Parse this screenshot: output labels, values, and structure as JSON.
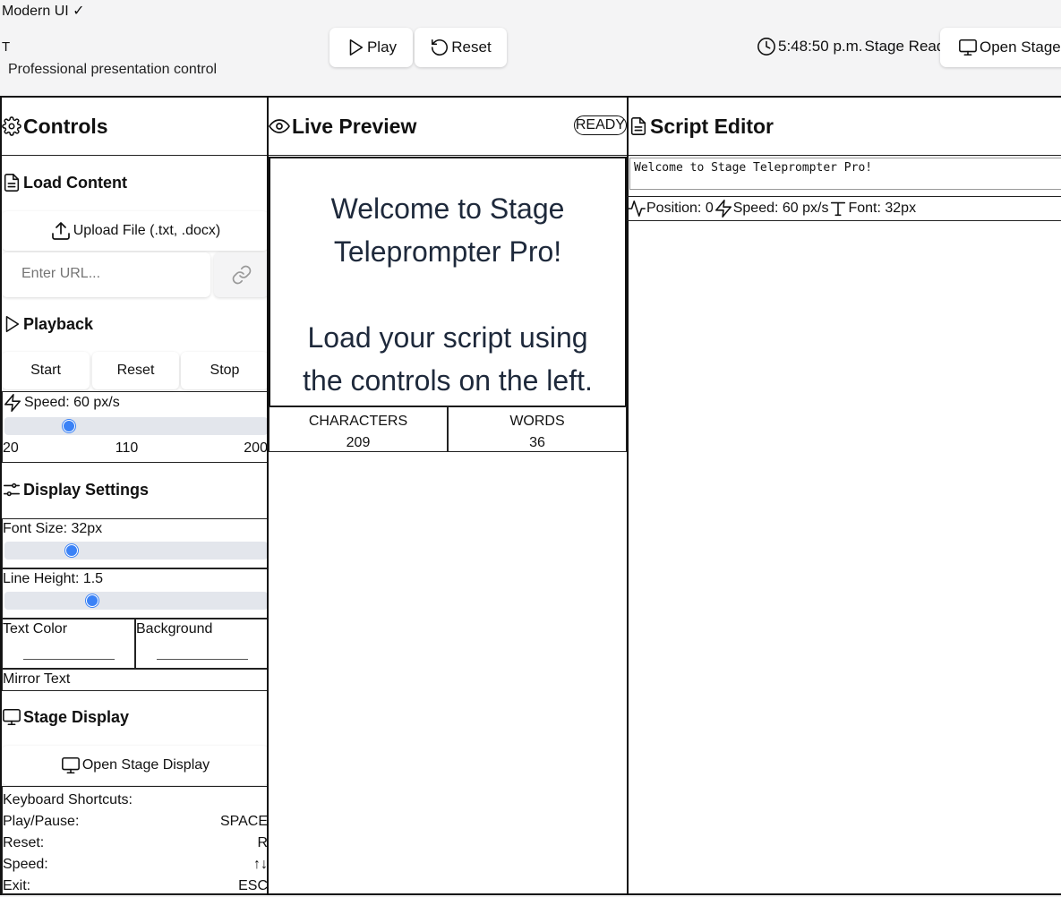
{
  "app": {
    "brand": "Modern UI ✓",
    "logo": "T",
    "subtitle": "Professional presentation control"
  },
  "header": {
    "play_label": "Play",
    "reset_label": "Reset",
    "time": "5:48:50 p.m.",
    "status": "Stage Ready",
    "open_stage_label": "Open Stage"
  },
  "controls": {
    "title": "Controls",
    "load_content": {
      "title": "Load Content",
      "upload_label": "Upload File (.txt, .docx)",
      "url_placeholder": "Enter URL..."
    },
    "playback": {
      "title": "Playback",
      "start_label": "Start",
      "reset_label": "Reset",
      "stop_label": "Stop",
      "speed_label": "Speed: 60 px/s",
      "speed_value": 60,
      "speed_min": "20",
      "speed_mid": "110",
      "speed_max": "200"
    },
    "display": {
      "title": "Display Settings",
      "font_size_label": "Font Size: 32px",
      "font_size_fraction": 0.23,
      "line_height_label": "Line Height: 1.5",
      "line_height_fraction": 0.31,
      "text_color_label": "Text Color",
      "background_label": "Background",
      "mirror_label": "Mirror Text"
    },
    "stage": {
      "title": "Stage Display",
      "open_label": "Open Stage Display",
      "shortcuts_title": "Keyboard Shortcuts:",
      "shortcuts": [
        {
          "action": "Play/Pause:",
          "key": "SPACE"
        },
        {
          "action": "Reset:",
          "key": "R"
        },
        {
          "action": "Speed:",
          "key": "↑↓"
        },
        {
          "action": "Exit:",
          "key": "ESC"
        }
      ]
    }
  },
  "preview": {
    "title": "Live Preview",
    "badge": "READY",
    "line1": "Welcome to Stage",
    "line2": "Teleprompter Pro!",
    "line3": "Load your script using",
    "line4": "the controls on the left.",
    "characters_label": "CHARACTERS",
    "characters_value": "209",
    "words_label": "WORDS",
    "words_value": "36"
  },
  "editor": {
    "title": "Script Editor",
    "text": "Welcome to Stage Teleprompter Pro!",
    "position_label": "Position: 0",
    "speed_label": "Speed: 60 px/s",
    "font_label": "Font: 32px"
  },
  "colors": {
    "accent": "#3b82f6",
    "track": "#e3e6ec",
    "preview_text": "#1e293b"
  }
}
